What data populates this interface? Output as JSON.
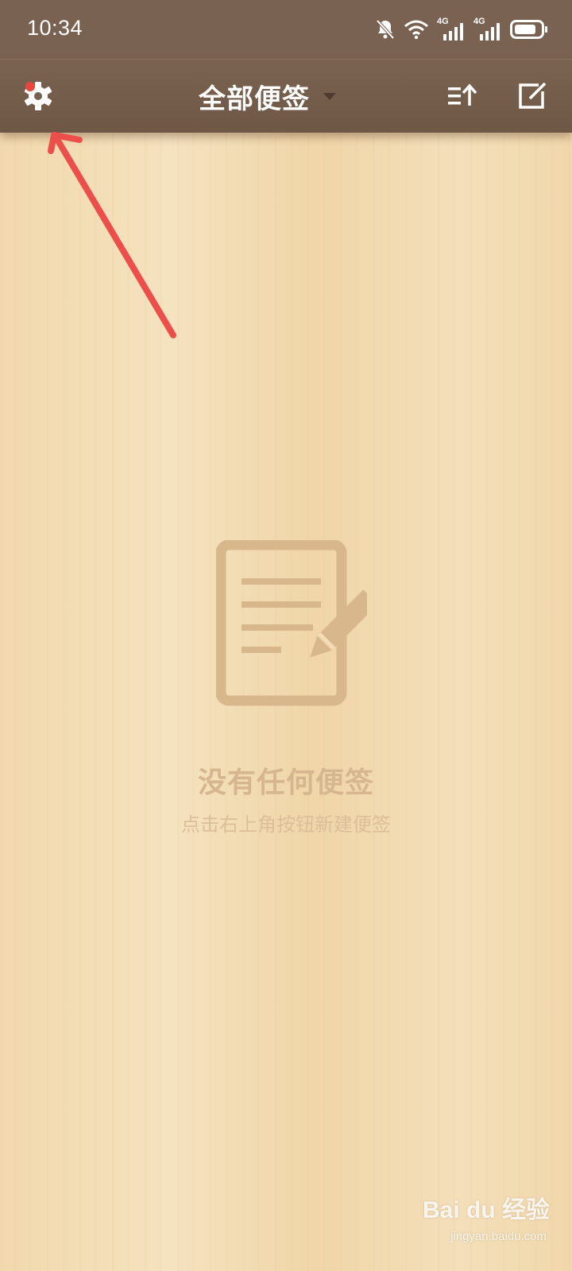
{
  "status_bar": {
    "time": "10:34",
    "icons": [
      "mute-bell-icon",
      "wifi-icon",
      "signal-4g-icon",
      "signal-4g-icon",
      "battery-icon"
    ],
    "network_label_1": "4G",
    "network_label_2": "4G"
  },
  "toolbar": {
    "title": "全部便签",
    "settings_icon": "gear-icon",
    "dropdown_icon": "caret-down-icon",
    "sort_icon": "sort-icon",
    "new_note_icon": "edit-icon"
  },
  "empty_state": {
    "icon": "note-edit-icon",
    "title": "没有任何便签",
    "subtitle": "点击右上角按钮新建便签"
  },
  "watermark": {
    "logo_text": "Bai du 经验",
    "url": "jingyan.baidu.com"
  },
  "colors": {
    "toolbar": "#7a6252",
    "annotation_arrow": "#ec4f4b",
    "badge": "#e8473e",
    "empty_text": "#d6b68f"
  }
}
